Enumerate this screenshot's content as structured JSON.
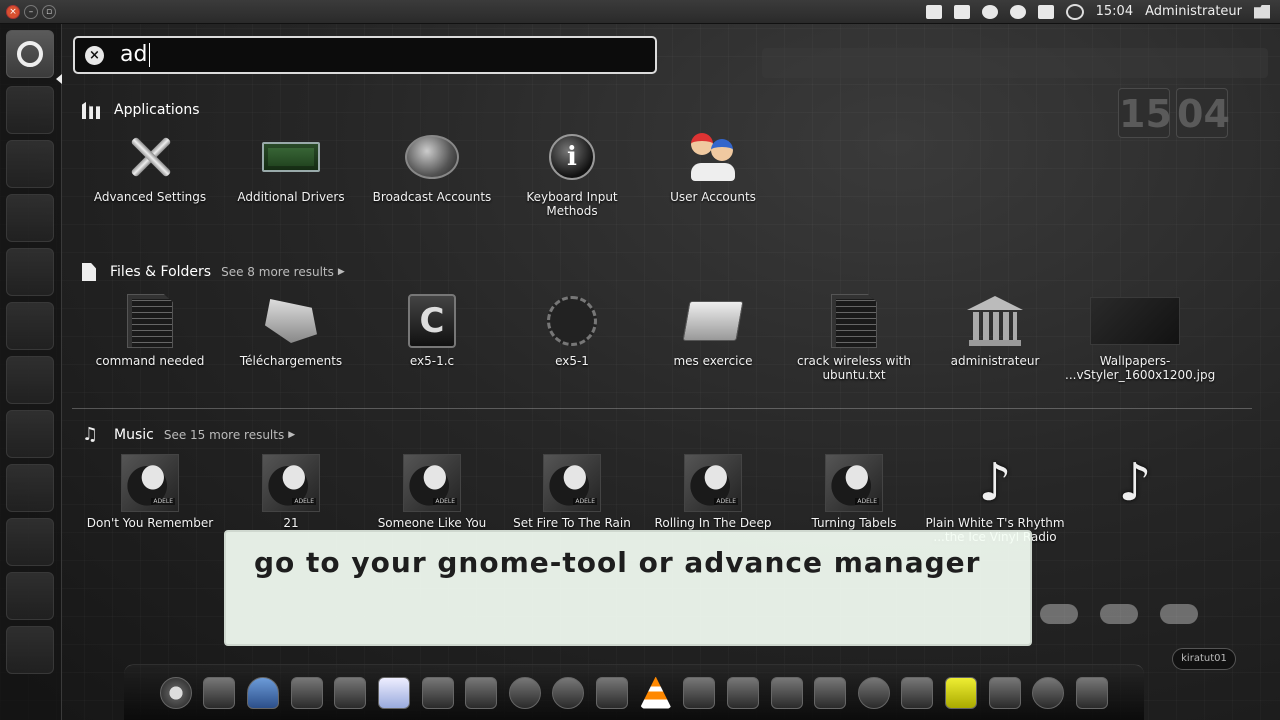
{
  "top_panel": {
    "time": "15:04",
    "user": "Administrateur"
  },
  "launcher": {
    "items": [
      "ubuntu-logo",
      "bookshelf",
      "disc",
      "hat",
      "tools",
      "window",
      "boxes",
      "camera",
      "sprout",
      "plant",
      "windows",
      "display"
    ]
  },
  "search": {
    "query": "ad"
  },
  "desktop_clock": {
    "hours": "15",
    "minutes": "04"
  },
  "sections": {
    "applications": {
      "title": "Applications",
      "items": [
        {
          "label": "Advanced Settings",
          "icon": "tools-icon"
        },
        {
          "label": "Additional Drivers",
          "icon": "circuit-board-icon"
        },
        {
          "label": "Broadcast Accounts",
          "icon": "speech-bubble-icon"
        },
        {
          "label": "Keyboard Input Methods",
          "icon": "info-icon"
        },
        {
          "label": "User Accounts",
          "icon": "users-icon"
        }
      ]
    },
    "files": {
      "title": "Files & Folders",
      "see_more": "See 8 more results",
      "items": [
        {
          "label": "command needed",
          "icon": "text-document-icon"
        },
        {
          "label": "Téléchargements",
          "icon": "folder-icon"
        },
        {
          "label": "ex5-1.c",
          "icon": "c-source-icon"
        },
        {
          "label": "ex5-1",
          "icon": "executable-icon"
        },
        {
          "label": "mes exercice",
          "icon": "folder-icon"
        },
        {
          "label": "crack wireless with",
          "label2": "ubuntu.txt",
          "icon": "text-document-icon"
        },
        {
          "label": "administrateur",
          "icon": "home-folder-icon"
        },
        {
          "label": "Wallpapers-",
          "label2": "...vStyler_1600x1200.jpg",
          "icon": "image-thumbnail-icon"
        }
      ]
    },
    "music": {
      "title": "Music",
      "see_more": "See 15 more results",
      "album_tag": "ADELE",
      "items": [
        {
          "label": "Don't You Remember",
          "icon": "album-art-icon"
        },
        {
          "label": "21",
          "icon": "album-art-icon"
        },
        {
          "label": "Someone Like You",
          "icon": "album-art-icon"
        },
        {
          "label": "Set Fire To The Rain",
          "icon": "album-art-icon"
        },
        {
          "label": "Rolling In The Deep",
          "icon": "album-art-icon"
        },
        {
          "label": "Turning Tabels",
          "icon": "album-art-icon"
        },
        {
          "label": "Plain White T's Rhythm",
          "label2": "...the Ice Vinyl Radio",
          "icon": "music-note-icon"
        },
        {
          "label": "",
          "icon": "music-note-icon"
        }
      ]
    }
  },
  "caption": {
    "text": "go to your gnome-tool or advance manager"
  },
  "watermark": "kiratut01"
}
